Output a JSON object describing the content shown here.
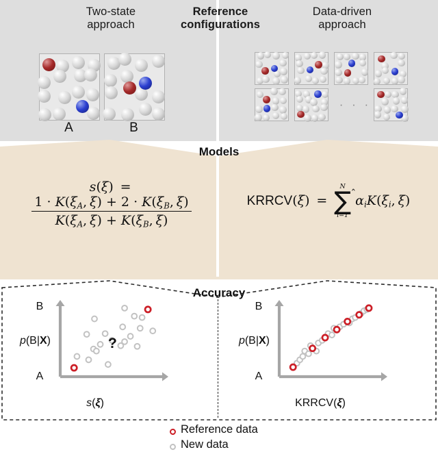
{
  "headers": {
    "left": "Two-state\napproach",
    "left_line1": "Two-state",
    "left_line2": "approach",
    "middle_line1": "Reference",
    "middle_line2": "configurations",
    "right_line1": "Data-driven",
    "right_line2": "approach"
  },
  "panels": {
    "models_title": "Models",
    "accuracy_title": "Accuracy"
  },
  "config_labels": {
    "a": "A",
    "b": "B",
    "ellipsis": "· · ·"
  },
  "formulas": {
    "left": {
      "lhs": "s(ξ) =",
      "numerator": "1 · K(ξ_A, ξ) + 2 · K(ξ_B, ξ)",
      "denominator": "K(ξ_A, ξ) + K(ξ_B, ξ)",
      "full": "s(ξ) = [1·K(ξ_A,ξ) + 2·K(ξ_B,ξ)] / [K(ξ_A,ξ) + K(ξ_B,ξ)]"
    },
    "right": {
      "lhs": "KRRCV(ξ) =",
      "sum_upper": "N",
      "sum_lower": "i=1",
      "term": "α̂_i K(ξ_i, ξ)",
      "full": "KRRCV(ξ) = Σ_{i=1}^{N} α̂_i K(ξ_i, ξ)"
    }
  },
  "plots": {
    "left": {
      "ytop": "B",
      "ybottom": "A",
      "ylabel": "p(B|X)",
      "xlabel": "s(ξ)",
      "annotation": "?"
    },
    "right": {
      "ytop": "B",
      "ybottom": "A",
      "ylabel": "p(B|X)",
      "xlabel": "KRRCV(ξ)"
    }
  },
  "legend": {
    "reference": "Reference data",
    "new": "New data"
  },
  "colors": {
    "panel_grey": "#dedede",
    "panel_beige": "#efe3d1",
    "panel_white": "#ffffff",
    "reference_red": "#cc1f27",
    "sphere_red": "#a52a2a",
    "sphere_blue": "#2b3fd0",
    "sphere_white": "#d8d8d8",
    "axis_grey": "#a6a6a6",
    "new_data_grey": "#c2c2c2",
    "text": "#111111"
  },
  "chart_data": [
    {
      "type": "scatter",
      "title": "Two-state approach accuracy",
      "xlabel": "s(ξ)",
      "ylabel": "p(B|X)",
      "ytick_labels": [
        "A",
        "B"
      ],
      "grid": false,
      "legend": [
        "Reference data",
        "New data"
      ],
      "annotation": "?",
      "series": [
        {
          "name": "Reference data",
          "color": "#cc1f27",
          "points": [
            [
              0.1,
              0.05
            ],
            [
              0.86,
              0.92
            ]
          ]
        },
        {
          "name": "New data",
          "color": "#c2c2c2",
          "points": [
            [
              0.62,
              0.94
            ],
            [
              0.31,
              0.78
            ],
            [
              0.72,
              0.82
            ],
            [
              0.8,
              0.8
            ],
            [
              0.6,
              0.66
            ],
            [
              0.78,
              0.64
            ],
            [
              0.91,
              0.6
            ],
            [
              0.23,
              0.55
            ],
            [
              0.68,
              0.52
            ],
            [
              0.49,
              0.46
            ],
            [
              0.62,
              0.44
            ],
            [
              0.37,
              0.4
            ],
            [
              0.58,
              0.38
            ],
            [
              0.75,
              0.37
            ],
            [
              0.3,
              0.33
            ],
            [
              0.33,
              0.3
            ],
            [
              0.13,
              0.22
            ],
            [
              0.25,
              0.17
            ],
            [
              0.45,
              0.1
            ],
            [
              0.42,
              0.56
            ]
          ]
        }
      ]
    },
    {
      "type": "scatter",
      "title": "Data-driven approach accuracy",
      "xlabel": "KRRCV(ξ)",
      "ylabel": "p(B|X)",
      "ytick_labels": [
        "A",
        "B"
      ],
      "grid": false,
      "legend": [
        "Reference data",
        "New data"
      ],
      "series": [
        {
          "name": "Reference data",
          "color": "#cc1f27",
          "points": [
            [
              0.1,
              0.06
            ],
            [
              0.3,
              0.34
            ],
            [
              0.43,
              0.5
            ],
            [
              0.55,
              0.62
            ],
            [
              0.66,
              0.74
            ],
            [
              0.78,
              0.84
            ],
            [
              0.88,
              0.94
            ]
          ]
        },
        {
          "name": "New data",
          "color": "#c2c2c2",
          "points": [
            [
              0.14,
              0.12
            ],
            [
              0.17,
              0.17
            ],
            [
              0.2,
              0.22
            ],
            [
              0.22,
              0.3
            ],
            [
              0.26,
              0.26
            ],
            [
              0.28,
              0.38
            ],
            [
              0.34,
              0.3
            ],
            [
              0.36,
              0.42
            ],
            [
              0.4,
              0.46
            ],
            [
              0.46,
              0.56
            ],
            [
              0.5,
              0.54
            ],
            [
              0.52,
              0.64
            ],
            [
              0.58,
              0.66
            ],
            [
              0.62,
              0.7
            ],
            [
              0.68,
              0.72
            ],
            [
              0.71,
              0.78
            ],
            [
              0.74,
              0.8
            ],
            [
              0.8,
              0.86
            ],
            [
              0.83,
              0.9
            ],
            [
              0.86,
              0.92
            ]
          ]
        }
      ]
    }
  ],
  "molecule_boxes": {
    "two_state": [
      {
        "label": "A",
        "description": "red and blue solute far apart",
        "red": [
          [
            0.16,
            0.16
          ]
        ],
        "blue": [
          [
            0.72,
            0.8
          ]
        ]
      },
      {
        "label": "B",
        "description": "red and blue solute adjacent",
        "red": [
          [
            0.42,
            0.52
          ]
        ],
        "blue": [
          [
            0.68,
            0.44
          ]
        ]
      }
    ],
    "data_driven_count": 7
  }
}
